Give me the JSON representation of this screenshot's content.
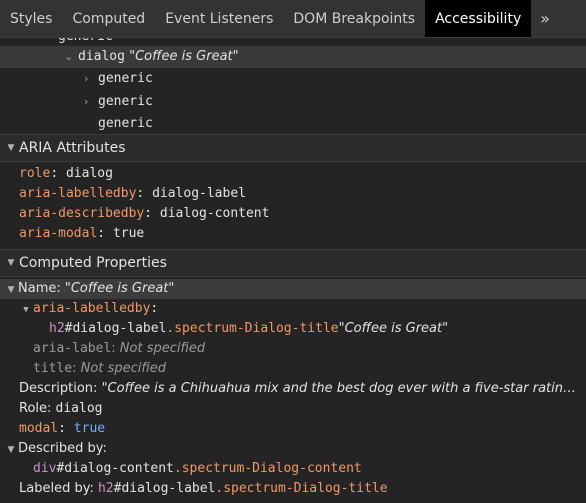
{
  "tabs": [
    {
      "label": "Styles"
    },
    {
      "label": "Computed"
    },
    {
      "label": "Event Listeners"
    },
    {
      "label": "DOM Breakpoints"
    },
    {
      "label": "Accessibility"
    }
  ],
  "tabs_more": "»",
  "tree": {
    "row0": "generic",
    "row1_role": "dialog",
    "row1_name": "\"Coffee is Great\"",
    "row2": "generic",
    "row3": "generic",
    "row4": "generic"
  },
  "aria_section": {
    "title": "ARIA Attributes",
    "attributes": [
      {
        "name": "role",
        "value": "dialog"
      },
      {
        "name": "aria-labelledby",
        "value": "dialog-label"
      },
      {
        "name": "aria-describedby",
        "value": "dialog-content"
      },
      {
        "name": "aria-modal",
        "value": "true"
      }
    ]
  },
  "computed_section": {
    "title": "Computed Properties",
    "name_label": "Name: ",
    "name_value": "\"Coffee is Great\"",
    "labelledby_label": "aria-labelledby",
    "labelledby_tag": "h2",
    "labelledby_id": "#dialog-label",
    "labelledby_class": ".spectrum-Dialog-title",
    "labelledby_text": "\"Coffee is Great\"",
    "aria_label_name": "aria-label",
    "aria_label_value": "Not specified",
    "title_name": "title",
    "title_value": "Not specified",
    "description_label": "Description: ",
    "description_value": "\"Coffee is a Chihuahua mix and the best dog ever with a five-star ratin…",
    "role_label": "Role: ",
    "role_value": "dialog",
    "modal_label": "modal",
    "modal_value": "true",
    "described_by_label": "Described by:",
    "described_tag": "div",
    "described_id": "#dialog-content",
    "described_class": ".spectrum-Dialog-content",
    "labeled_by_label": "Labeled by: ",
    "labeled_tag": "h2",
    "labeled_id": "#dialog-label",
    "labeled_class": ".spectrum-Dialog-title"
  }
}
